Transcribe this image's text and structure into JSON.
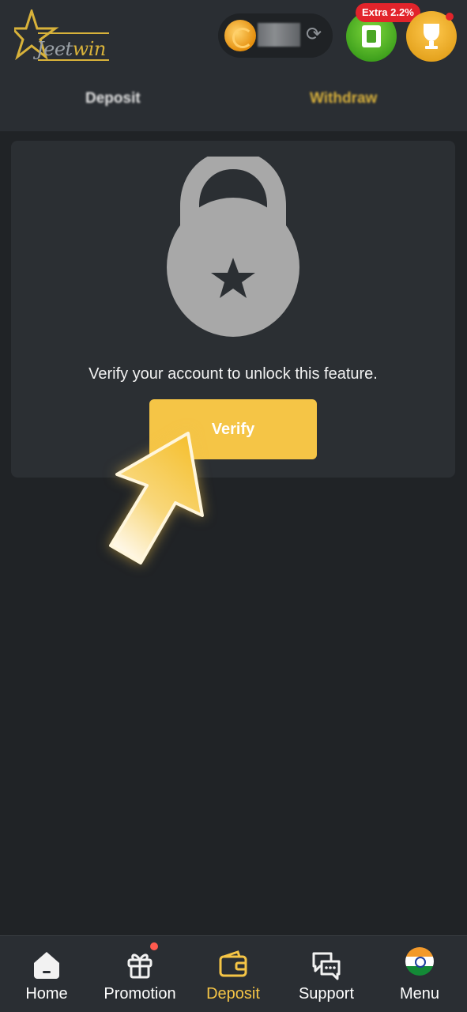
{
  "header": {
    "logo_text_a": "Jeet",
    "logo_text_b": "win",
    "extra_badge": "Extra 2.2%",
    "tabs": [
      {
        "label": "Deposit"
      },
      {
        "label": "Withdraw"
      }
    ]
  },
  "card": {
    "message": "Verify your account to unlock this feature.",
    "verify_label": "Verify"
  },
  "bottom_nav": {
    "items": [
      {
        "label": "Home",
        "icon": "home-icon"
      },
      {
        "label": "Promotion",
        "icon": "gift-icon"
      },
      {
        "label": "Deposit",
        "icon": "wallet-icon"
      },
      {
        "label": "Support",
        "icon": "chat-icon"
      },
      {
        "label": "Menu",
        "icon": "india-flag-icon"
      }
    ]
  },
  "colors": {
    "accent": "#f5c546",
    "background": "#202326",
    "card": "#2b2f33",
    "header": "#2a2e33"
  }
}
